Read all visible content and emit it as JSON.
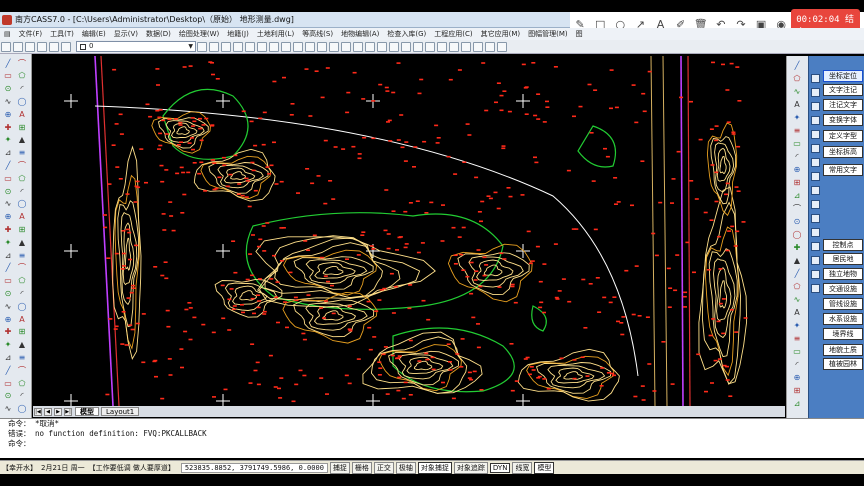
{
  "window": {
    "title": "南方CASS7.0 - [C:\\Users\\Administrator\\Desktop\\（原始） 地形测量.dwg]"
  },
  "recorder": {
    "time": "00:02:04",
    "time_action": "结束"
  },
  "menu": [
    "文件(F)",
    "工具(T)",
    "编辑(E)",
    "显示(V)",
    "数据(D)",
    "绘图处理(W)",
    "地籍(J)",
    "土地利用(L)",
    "等高线(S)",
    "地物编辑(A)",
    "检查入库(G)",
    "工程应用(C)",
    "其它应用(M)",
    "图幅管理(M)",
    "图"
  ],
  "layer": {
    "current": "0"
  },
  "tabs": {
    "model": "模型",
    "layout": "Layout1"
  },
  "right_panel": {
    "items": [
      "坐标定位",
      "文字注记",
      "注记文字",
      "变换字体",
      "定义字型",
      "坐标拆高",
      "常用文字",
      "控制点",
      "居民地",
      "独立地物",
      "交通设施",
      "管线设施",
      "水系设施",
      "境界线",
      "地貌土质",
      "植被园林"
    ],
    "selected": "坐标定位"
  },
  "command": {
    "lines": [
      "命令： *取消*",
      "错误： no function definition: FVQ:PKCALLBACK",
      "命令："
    ]
  },
  "status": {
    "taskbar_app": "【幸开水】",
    "date": "2月21日 周一",
    "task": "【工作要低调 做人要厚道】",
    "coords": "523835.8852,  3791749.5986,  0.0000",
    "modes": [
      {
        "label": "捕捉",
        "on": false
      },
      {
        "label": "栅格",
        "on": false
      },
      {
        "label": "正交",
        "on": false
      },
      {
        "label": "极轴",
        "on": false
      },
      {
        "label": "对象捕捉",
        "on": true
      },
      {
        "label": "对象追踪",
        "on": false
      },
      {
        "label": "DYN",
        "on": true
      },
      {
        "label": "线宽",
        "on": false
      },
      {
        "label": "模型",
        "on": true
      }
    ]
  },
  "colors": {
    "canvas": "#000000",
    "contour_primary": "#ffe08a",
    "contour_index": "#e8a020",
    "contour_green": "#22cc33",
    "points": "#ff2a1a",
    "boundary": "#c040ff",
    "road": "#ffffff",
    "panel": "#4b7ec2"
  }
}
